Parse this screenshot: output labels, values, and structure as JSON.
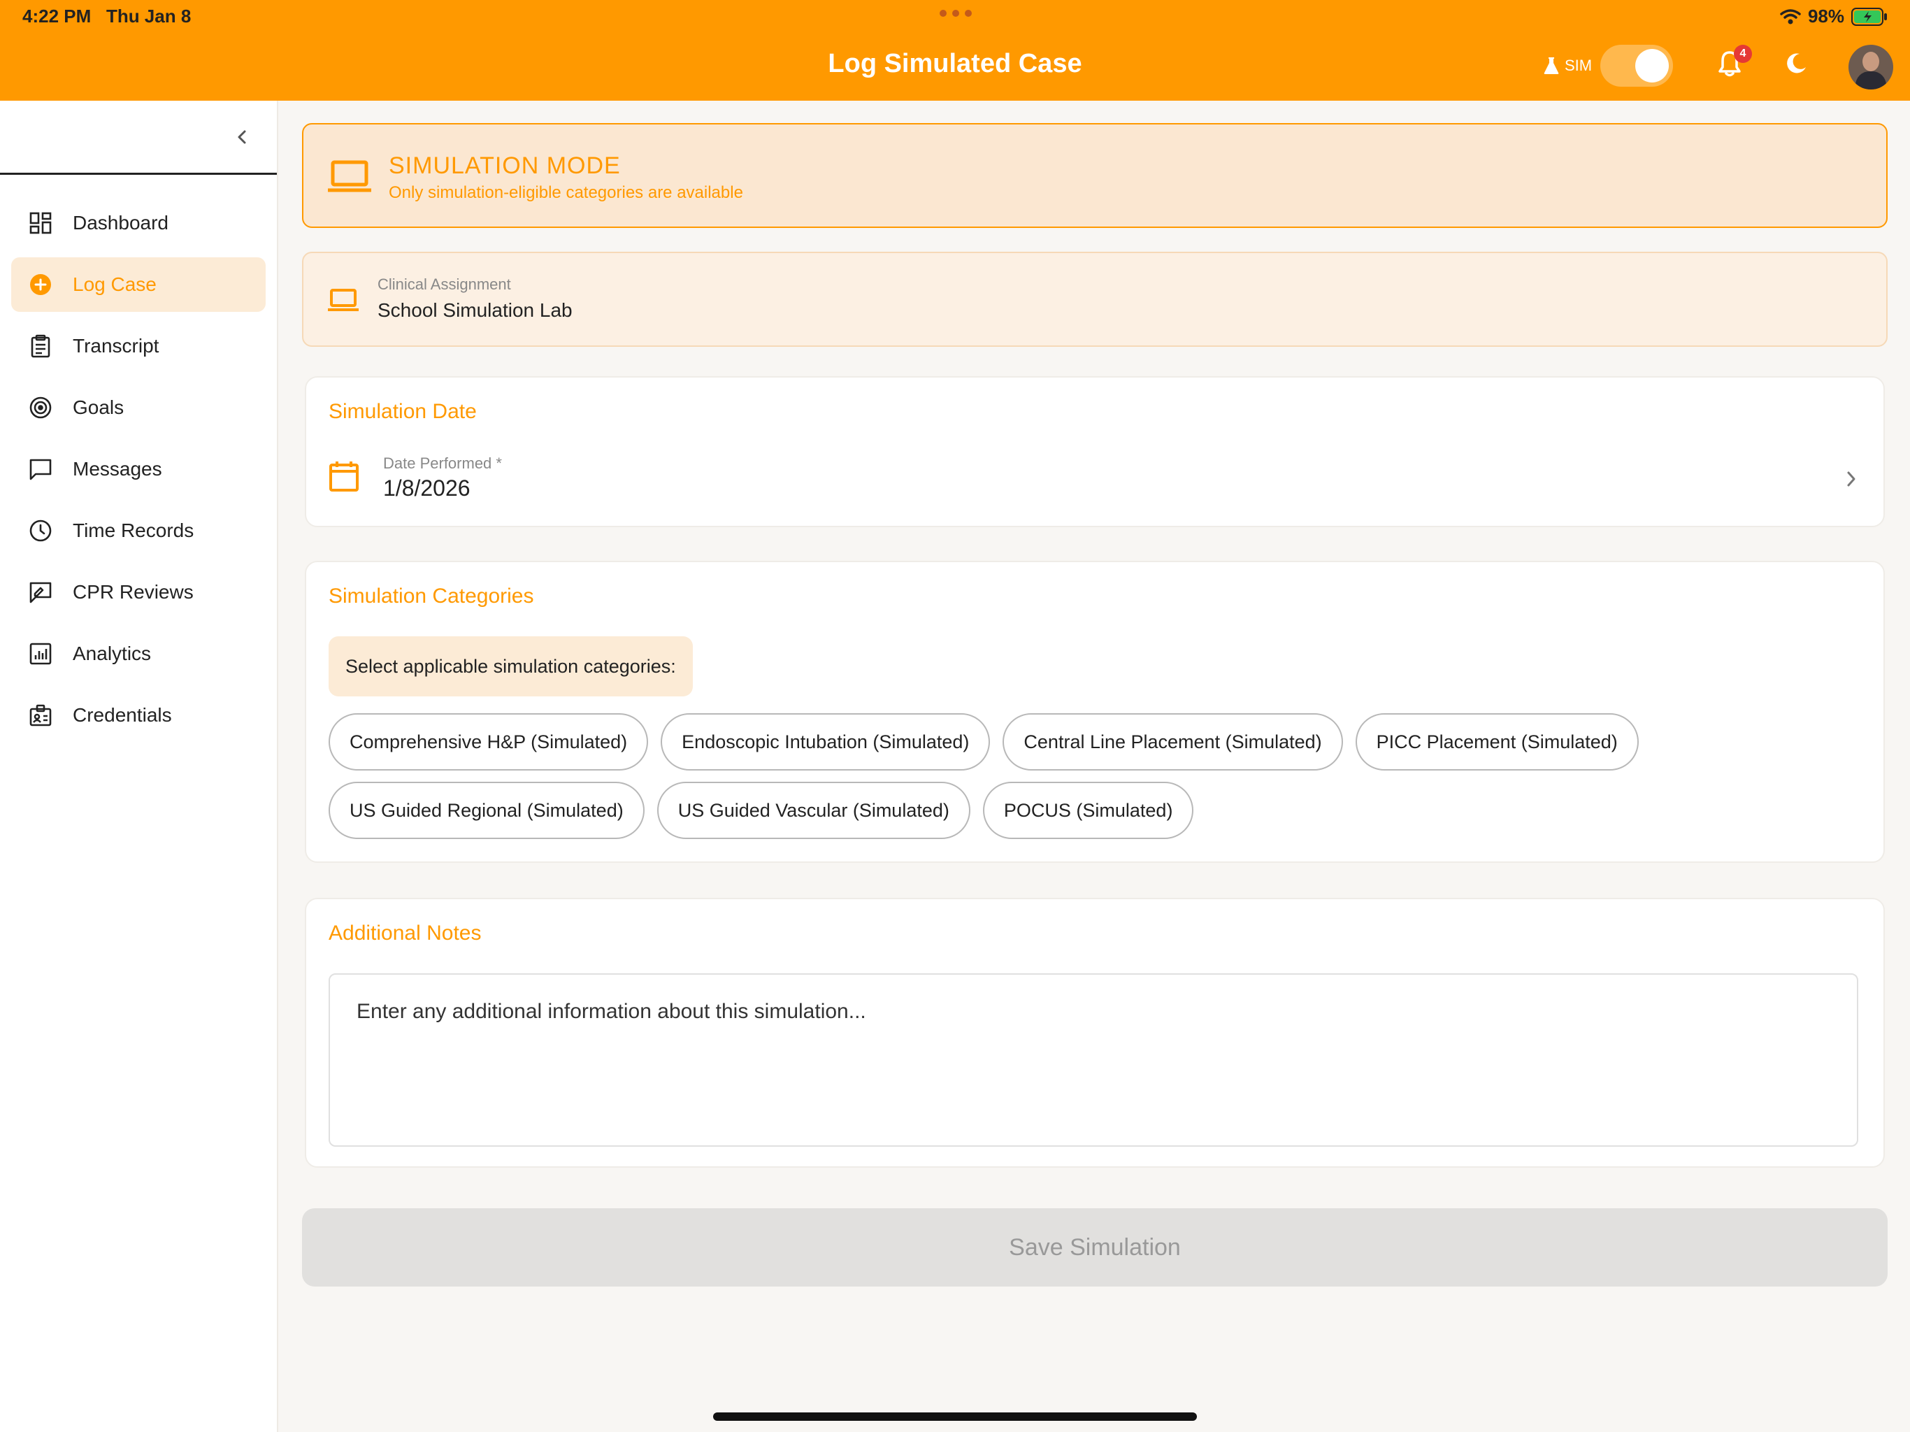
{
  "status_bar": {
    "time": "4:22 PM",
    "date": "Thu Jan 8",
    "battery": "98%"
  },
  "header": {
    "title": "Log Simulated Case",
    "sim_label": "SIM",
    "sim_enabled": true,
    "notification_count": "4",
    "accent_color": "#ff9900"
  },
  "sidebar": {
    "items": [
      {
        "label": "Dashboard",
        "icon": "dashboard-icon"
      },
      {
        "label": "Log Case",
        "icon": "plus-circle-icon",
        "active": true
      },
      {
        "label": "Transcript",
        "icon": "clipboard-icon"
      },
      {
        "label": "Goals",
        "icon": "target-icon"
      },
      {
        "label": "Messages",
        "icon": "message-icon"
      },
      {
        "label": "Time Records",
        "icon": "clock-icon"
      },
      {
        "label": "CPR Reviews",
        "icon": "review-icon"
      },
      {
        "label": "Analytics",
        "icon": "analytics-icon"
      },
      {
        "label": "Credentials",
        "icon": "credentials-icon"
      }
    ]
  },
  "banner": {
    "title": "SIMULATION MODE",
    "subtitle": "Only simulation-eligible categories are available"
  },
  "assignment": {
    "label": "Clinical Assignment",
    "value": "School Simulation Lab"
  },
  "date_section": {
    "title": "Simulation Date",
    "field_label": "Date Performed *",
    "value": "1/8/2026"
  },
  "categories_section": {
    "title": "Simulation Categories",
    "hint": "Select applicable simulation categories:",
    "chips": [
      "Comprehensive H&P (Simulated)",
      "Endoscopic Intubation (Simulated)",
      "Central Line Placement (Simulated)",
      "PICC Placement (Simulated)",
      "US Guided Regional (Simulated)",
      "US Guided Vascular (Simulated)",
      "POCUS (Simulated)"
    ]
  },
  "notes_section": {
    "title": "Additional Notes",
    "placeholder": "Enter any additional information about this simulation..."
  },
  "save_button": {
    "label": "Save Simulation"
  }
}
